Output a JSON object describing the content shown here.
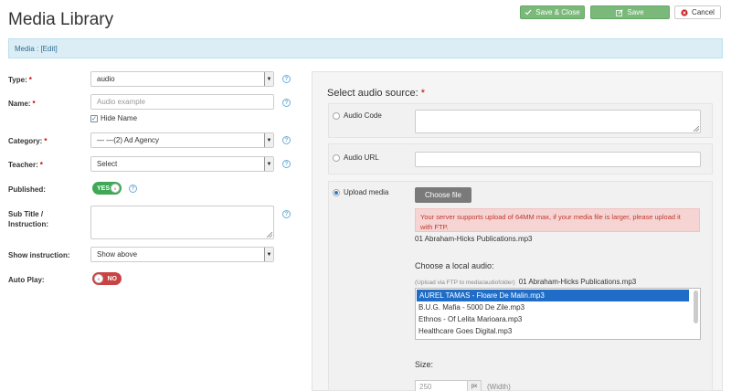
{
  "header": {
    "title": "Media Library",
    "save_close_label": "Save & Close",
    "save_label": "Save",
    "cancel_label": "Cancel"
  },
  "alert": {
    "text": "Media : [Edit]"
  },
  "form": {
    "type": {
      "label": "Type:",
      "value": "audio"
    },
    "name": {
      "label": "Name:",
      "placeholder": "Audio example",
      "hide_name_label": "Hide Name",
      "hide_name_checked": true
    },
    "category": {
      "label": "Category:",
      "value": "— —(2) Ad Agency"
    },
    "teacher": {
      "label": "Teacher:",
      "value": "Select"
    },
    "published": {
      "label": "Published:",
      "value": "YES"
    },
    "subtitle": {
      "label_line1": "Sub Title /",
      "label_line2": "Instruction:"
    },
    "show_instruction": {
      "label": "Show instruction:",
      "value": "Show above"
    },
    "auto_play": {
      "label": "Auto Play:",
      "value": "NO"
    }
  },
  "audio_source": {
    "title": "Select audio source:",
    "audio_code_label": "Audio Code",
    "audio_url_label": "Audio URL",
    "upload_media_label": "Upload media",
    "selected": "upload_media",
    "choose_file_label": "Choose file",
    "warning": "Your server supports upload of 64MM max, if your media file is larger, please upload it with FTP.",
    "current_file": "01 Abraham-Hicks Publications.mp3",
    "choose_local_title": "Choose a local audio:",
    "ftp_hint": "(Upload via FTP to media/audiofolder)",
    "ftp_file": "01 Abraham-Hicks Publications.mp3",
    "local_files": [
      "AUREL TAMAS - Floare De Malin.mp3",
      "B.U.G. Mafia - 5000 De Zile.mp3",
      "Ethnos - Of Lelita Marioara.mp3",
      "Healthcare Goes Digital.mp3"
    ],
    "size_title": "Size:",
    "width_value": "250",
    "width_unit": "px",
    "width_caption": "(Width)"
  },
  "colors": {
    "accent_green": "#7ab97a",
    "alert_bg": "#dbeef6",
    "toggle_yes": "#3fa856",
    "toggle_no": "#c94343",
    "selected_row": "#1f6dc6"
  }
}
